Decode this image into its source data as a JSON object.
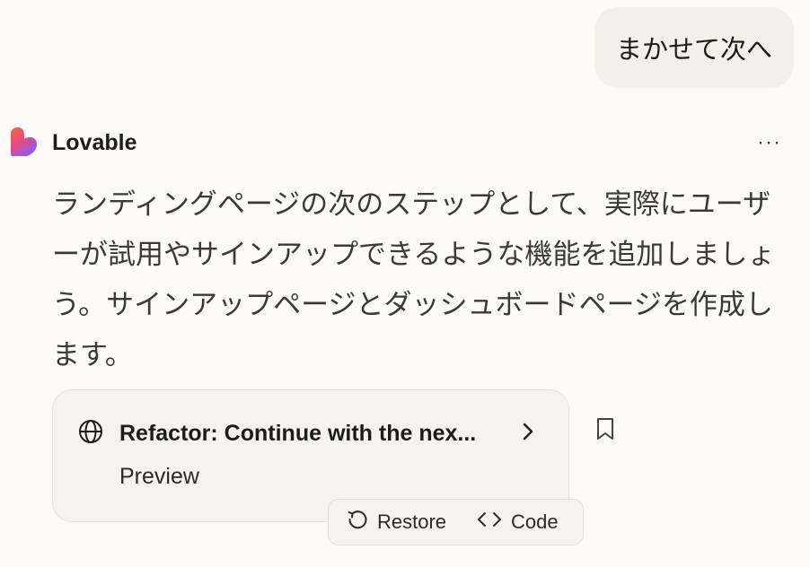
{
  "user_message": {
    "text": "まかせて次へ"
  },
  "assistant": {
    "name": "Lovable",
    "more_label": "···",
    "message": "ランディングページの次のステップとして、実際にユーザーが試用やサインアップできるような機能を追加しましょう。サインアップページとダッシュボードページを作成します。"
  },
  "change_card": {
    "icon": "globe-icon",
    "title": "Refactor: Continue with the nex...",
    "subtitle": "Preview"
  },
  "actions": {
    "restore_label": "Restore",
    "code_label": "Code"
  },
  "colors": {
    "background": "#fcfbf8",
    "bubble": "#f3f0ea",
    "card": "#f5f3ee",
    "text": "#1c1c1c",
    "logo_gradient_top": "#f2683a",
    "logo_gradient_bottom": "#8b5cf6"
  }
}
